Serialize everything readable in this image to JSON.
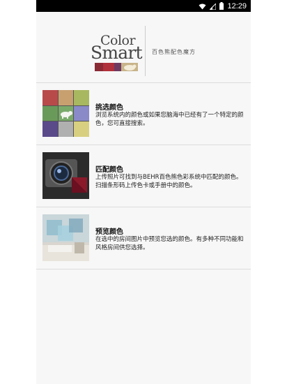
{
  "status_bar": {
    "time": "12:29",
    "icons": [
      "wifi-icon",
      "signal-icon",
      "battery-icon"
    ]
  },
  "header": {
    "logo_line1": "Color",
    "logo_line2": "Smart",
    "tagline": "百色熊配色魔方",
    "logo_colors": [
      "#8a2a35",
      "#b0303b",
      "#6e3a60",
      "#c8b48a"
    ]
  },
  "menu": [
    {
      "title": "挑选颜色",
      "description": "浏览系统内的颜色或如果您脑海中已经有了一个特定的颜色，您可直接搜索。",
      "thumb": "color-grid"
    },
    {
      "title": "匹配颜色",
      "description": "上传照片可找到与BEHR百色熊色彩系统中匹配的颜色。扫描条形码上传色卡或手册中的颜色。",
      "thumb": "camera"
    },
    {
      "title": "预览颜色",
      "description": "在选中的房间图片中预览您选的颜色。有多种不同功能和风格房间供您选择。",
      "thumb": "room"
    }
  ],
  "palette": {
    "grid_colors": [
      "#b84a4a",
      "#c8a070",
      "#a8b860",
      "#6a9a5a",
      "#7aaa6a",
      "#8a8ac8",
      "#5a4a8a",
      "#b0b0b0",
      "#d8d080"
    ],
    "accent_red": "#b0303b"
  }
}
